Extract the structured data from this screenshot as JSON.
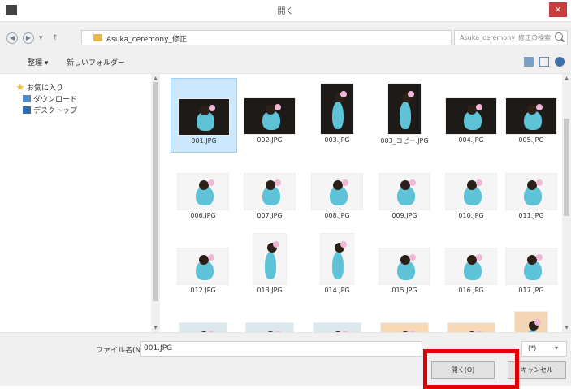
{
  "window": {
    "title": "開く",
    "close_symbol": "×"
  },
  "address": {
    "path": "Asuka_ceremony_修正",
    "search_placeholder": "Asuka_ceremony_修正の検索"
  },
  "toolbar": {
    "organize": "整理 ▾",
    "new_folder": "新しいフォルダー"
  },
  "nav_pane": [
    {
      "label": "お気に入り",
      "icon": "star-icon"
    },
    {
      "label": "ダウンロード",
      "icon": "download-folder-icon"
    },
    {
      "label": "デスクトップ",
      "icon": "desktop-icon"
    }
  ],
  "files": [
    {
      "name": "001.JPG",
      "type": "landscape",
      "selected": true
    },
    {
      "name": "002.JPG",
      "type": "landscape"
    },
    {
      "name": "003.JPG",
      "type": "portrait"
    },
    {
      "name": "003_コピー.JPG",
      "type": "portrait"
    },
    {
      "name": "004.JPG",
      "type": "landscape"
    },
    {
      "name": "005.JPG",
      "type": "landscape"
    },
    {
      "name": "006.JPG",
      "type": "landscape-light"
    },
    {
      "name": "007.JPG",
      "type": "landscape-light"
    },
    {
      "name": "008.JPG",
      "type": "landscape-light"
    },
    {
      "name": "009.JPG",
      "type": "landscape-light"
    },
    {
      "name": "010.JPG",
      "type": "landscape-light"
    },
    {
      "name": "011.JPG",
      "type": "landscape-light"
    },
    {
      "name": "012.JPG",
      "type": "landscape-light"
    },
    {
      "name": "013.JPG",
      "type": "portrait-light"
    },
    {
      "name": "014.JPG",
      "type": "portrait-light"
    },
    {
      "name": "015.JPG",
      "type": "landscape-light"
    },
    {
      "name": "016.JPG",
      "type": "landscape-light"
    },
    {
      "name": "017.JPG",
      "type": "landscape-light"
    },
    {
      "name": "",
      "type": "closeup"
    },
    {
      "name": "",
      "type": "closeup"
    },
    {
      "name": "",
      "type": "closeup"
    },
    {
      "name": "",
      "type": "warm"
    },
    {
      "name": "",
      "type": "warm"
    },
    {
      "name": "",
      "type": "portrait-warm"
    }
  ],
  "bottom": {
    "filename_label": "ファイル名(N):",
    "filename_value": "001.JPG",
    "filter_value": "(*)",
    "open_button": "開く(O)",
    "cancel_button": "キャンセル"
  },
  "colors": {
    "highlight": "#e10000",
    "selection": "#cce8ff"
  }
}
